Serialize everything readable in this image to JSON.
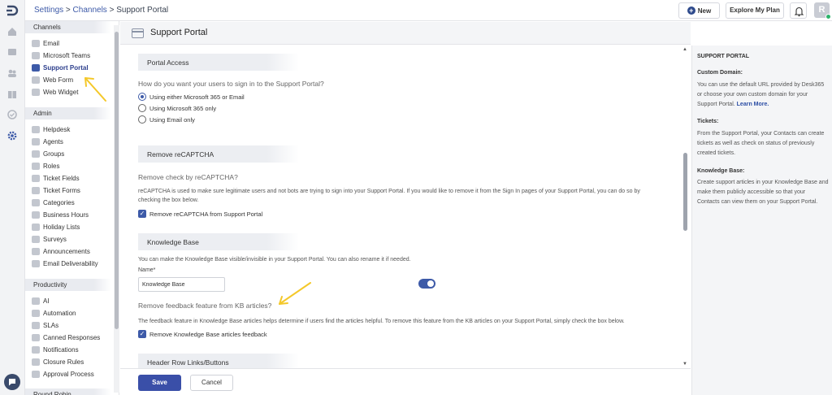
{
  "breadcrumb": {
    "settings": "Settings",
    "sep1": " > ",
    "channels": "Channels",
    "sep2": " > ",
    "current": "Support Portal"
  },
  "topbar": {
    "new_label": "New",
    "plus_glyph": "+",
    "explore_label": "Explore My Plan",
    "avatar_initial": "R"
  },
  "nav": {
    "channels_heading": "Channels",
    "channels": [
      {
        "label": "Email"
      },
      {
        "label": "Microsoft Teams"
      },
      {
        "label": "Support Portal"
      },
      {
        "label": "Web Form"
      },
      {
        "label": "Web Widget"
      }
    ],
    "admin_heading": "Admin",
    "admin": [
      {
        "label": "Helpdesk"
      },
      {
        "label": "Agents"
      },
      {
        "label": "Groups"
      },
      {
        "label": "Roles"
      },
      {
        "label": "Ticket Fields"
      },
      {
        "label": "Ticket Forms"
      },
      {
        "label": "Categories"
      },
      {
        "label": "Business Hours"
      },
      {
        "label": "Holiday Lists"
      },
      {
        "label": "Surveys"
      },
      {
        "label": "Announcements"
      },
      {
        "label": "Email Deliverability"
      }
    ],
    "productivity_heading": "Productivity",
    "productivity": [
      {
        "label": "AI"
      },
      {
        "label": "Automation"
      },
      {
        "label": "SLAs"
      },
      {
        "label": "Canned Responses"
      },
      {
        "label": "Notifications"
      },
      {
        "label": "Closure Rules"
      },
      {
        "label": "Approval Process"
      }
    ],
    "roundrobin_heading": "Round Robin"
  },
  "page": {
    "title": "Support Portal"
  },
  "portal_access": {
    "heading": "Portal Access",
    "question": "How do you want your users to sign in to the Support Portal?",
    "options": [
      {
        "label": "Using either Microsoft 365 or Email",
        "selected": true
      },
      {
        "label": "Using Microsoft 365 only",
        "selected": false
      },
      {
        "label": "Using Email only",
        "selected": false
      }
    ]
  },
  "recaptcha": {
    "heading": "Remove reCAPTCHA",
    "question": "Remove check by reCAPTCHA?",
    "description": "reCAPTCHA is used to make sure legitimate users and not bots are trying to sign into your Support Portal. If you would like to remove it from the Sign In pages of your Support Portal, you can do so by checking the box below.",
    "checkbox_label": "Remove reCAPTCHA from Support Portal",
    "checked": true
  },
  "knowledge_base": {
    "heading": "Knowledge Base",
    "description": "You can make the Knowledge Base visible/invisible in your Support Portal. You can also rename it if needed.",
    "name_label": "Name*",
    "name_value": "Knowledge Base",
    "visible": true,
    "feedback_question": "Remove feedback feature from KB articles?",
    "feedback_description": "The feedback feature in Knowledge Base articles helps determine if users find the articles helpful. To remove this feature from the KB articles on your Support Portal, simply check the box below.",
    "feedback_checkbox_label": "Remove Knowledge Base articles feedback",
    "feedback_checked": true
  },
  "header_links": {
    "heading": "Header Row Links/Buttons"
  },
  "footer": {
    "save_label": "Save",
    "cancel_label": "Cancel"
  },
  "help": {
    "title": "SUPPORT PORTAL",
    "custom_domain_heading": "Custom Domain:",
    "custom_domain_text": "You can use the default URL provided by Desk365 or choose your own custom domain for your Support Portal.",
    "learn_more": "Learn More.",
    "tickets_heading": "Tickets:",
    "tickets_text": "From the Support Portal, your Contacts can create tickets as well as check on status of previously created tickets.",
    "kb_heading": "Knowledge Base:",
    "kb_text": "Create support articles in your Knowledge Base and make them publicly accessible so that your Contacts can view them on your Support Portal."
  },
  "colors": {
    "accent": "#3d5aa8",
    "save_button": "#3a4fa8",
    "annotation_arrow": "#f4c82a"
  },
  "icons": [
    "logo-icon",
    "home-icon",
    "inbox-icon",
    "contacts-icon",
    "knowledge-base-icon",
    "tasks-icon",
    "settings-icon",
    "chat-icon",
    "plus-icon",
    "bell-icon",
    "portal-icon"
  ]
}
